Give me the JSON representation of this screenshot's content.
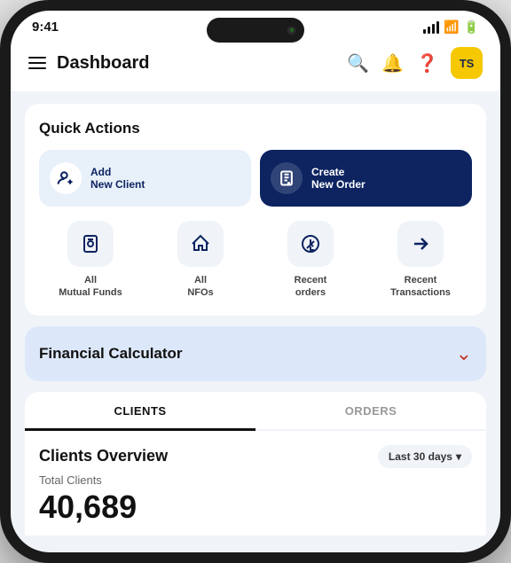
{
  "statusBar": {
    "time": "9:41"
  },
  "header": {
    "title": "Dashboard",
    "avatarText": "TS"
  },
  "quickActions": {
    "sectionTitle": "Quick Actions",
    "btn1": {
      "line1": "Add",
      "line2": "New Client"
    },
    "btn2": {
      "line1": "Create",
      "line2": "New Order"
    },
    "gridItems": [
      {
        "label": "All\nMutual Funds",
        "icon": "🪪"
      },
      {
        "label": "All\nNFOs",
        "icon": "🏠"
      },
      {
        "label": "Recent\norders",
        "icon": "⬇"
      },
      {
        "label": "Recent\nTransactions",
        "icon": "→"
      }
    ]
  },
  "financialCalculator": {
    "title": "Financial Calculator"
  },
  "tabs": {
    "items": [
      "CLIENTS",
      "ORDERS"
    ],
    "activeIndex": 0
  },
  "clientsOverview": {
    "title": "Clients Overview",
    "period": "Last 30 days",
    "totalLabel": "Total Clients",
    "totalNumber": "40,689"
  }
}
